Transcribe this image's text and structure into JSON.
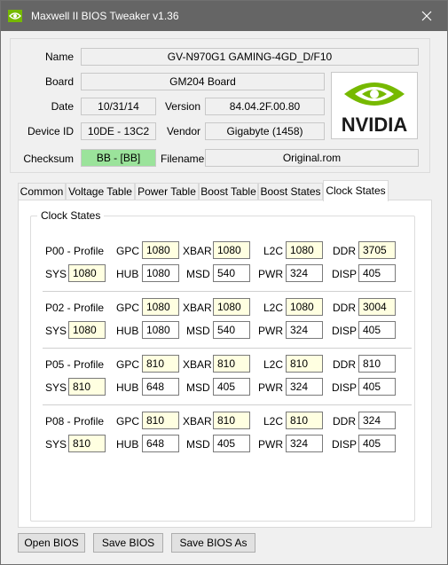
{
  "window": {
    "title": "Maxwell II BIOS Tweaker v1.36"
  },
  "info": {
    "name_label": "Name",
    "name_value": "GV-N970G1 GAMING-4GD_D/F10",
    "board_label": "Board",
    "board_value": "GM204 Board",
    "date_label": "Date",
    "date_value": "10/31/14",
    "version_label": "Version",
    "version_value": "84.04.2F.00.80",
    "deviceid_label": "Device ID",
    "deviceid_value": "10DE - 13C2",
    "vendor_label": "Vendor",
    "vendor_value": "Gigabyte (1458)",
    "checksum_label": "Checksum",
    "checksum_value": "BB - [BB]",
    "filename_label": "Filename",
    "filename_value": "Original.rom",
    "logo_text": "NVIDIA"
  },
  "tabs": [
    "Common",
    "Voltage Table",
    "Power Table",
    "Boost Table",
    "Boost States",
    "Clock States"
  ],
  "active_tab": "Clock States",
  "clock_group_title": "Clock States",
  "profiles": [
    {
      "name": "P00 - Profile",
      "gpc": "1080",
      "xbar": "1080",
      "l2c": "1080",
      "ddr": "3705",
      "sys": "1080",
      "hub": "1080",
      "msd": "540",
      "pwr": "324",
      "disp": "405"
    },
    {
      "name": "P02 - Profile",
      "gpc": "1080",
      "xbar": "1080",
      "l2c": "1080",
      "ddr": "3004",
      "sys": "1080",
      "hub": "1080",
      "msd": "540",
      "pwr": "324",
      "disp": "405"
    },
    {
      "name": "P05 - Profile",
      "gpc": "810",
      "xbar": "810",
      "l2c": "810",
      "ddr": "810",
      "sys": "810",
      "hub": "648",
      "msd": "405",
      "pwr": "324",
      "disp": "405"
    },
    {
      "name": "P08 - Profile",
      "gpc": "810",
      "xbar": "810",
      "l2c": "810",
      "ddr": "324",
      "sys": "810",
      "hub": "648",
      "msd": "405",
      "pwr": "324",
      "disp": "405"
    }
  ],
  "field_labels": {
    "gpc": "GPC",
    "xbar": "XBAR",
    "l2c": "L2C",
    "ddr": "DDR",
    "sys": "SYS",
    "hub": "HUB",
    "msd": "MSD",
    "pwr": "PWR",
    "disp": "DISP"
  },
  "buttons": {
    "open": "Open BIOS",
    "save": "Save BIOS",
    "save_as": "Save BIOS As"
  },
  "colors": {
    "checksum_ok": "#9be39b",
    "modified_field": "#ffffe1",
    "titlebar": "#656565",
    "nvidia_green": "#76b900"
  },
  "icons": {
    "app": "nvidia-eye-icon",
    "close": "close-icon"
  }
}
